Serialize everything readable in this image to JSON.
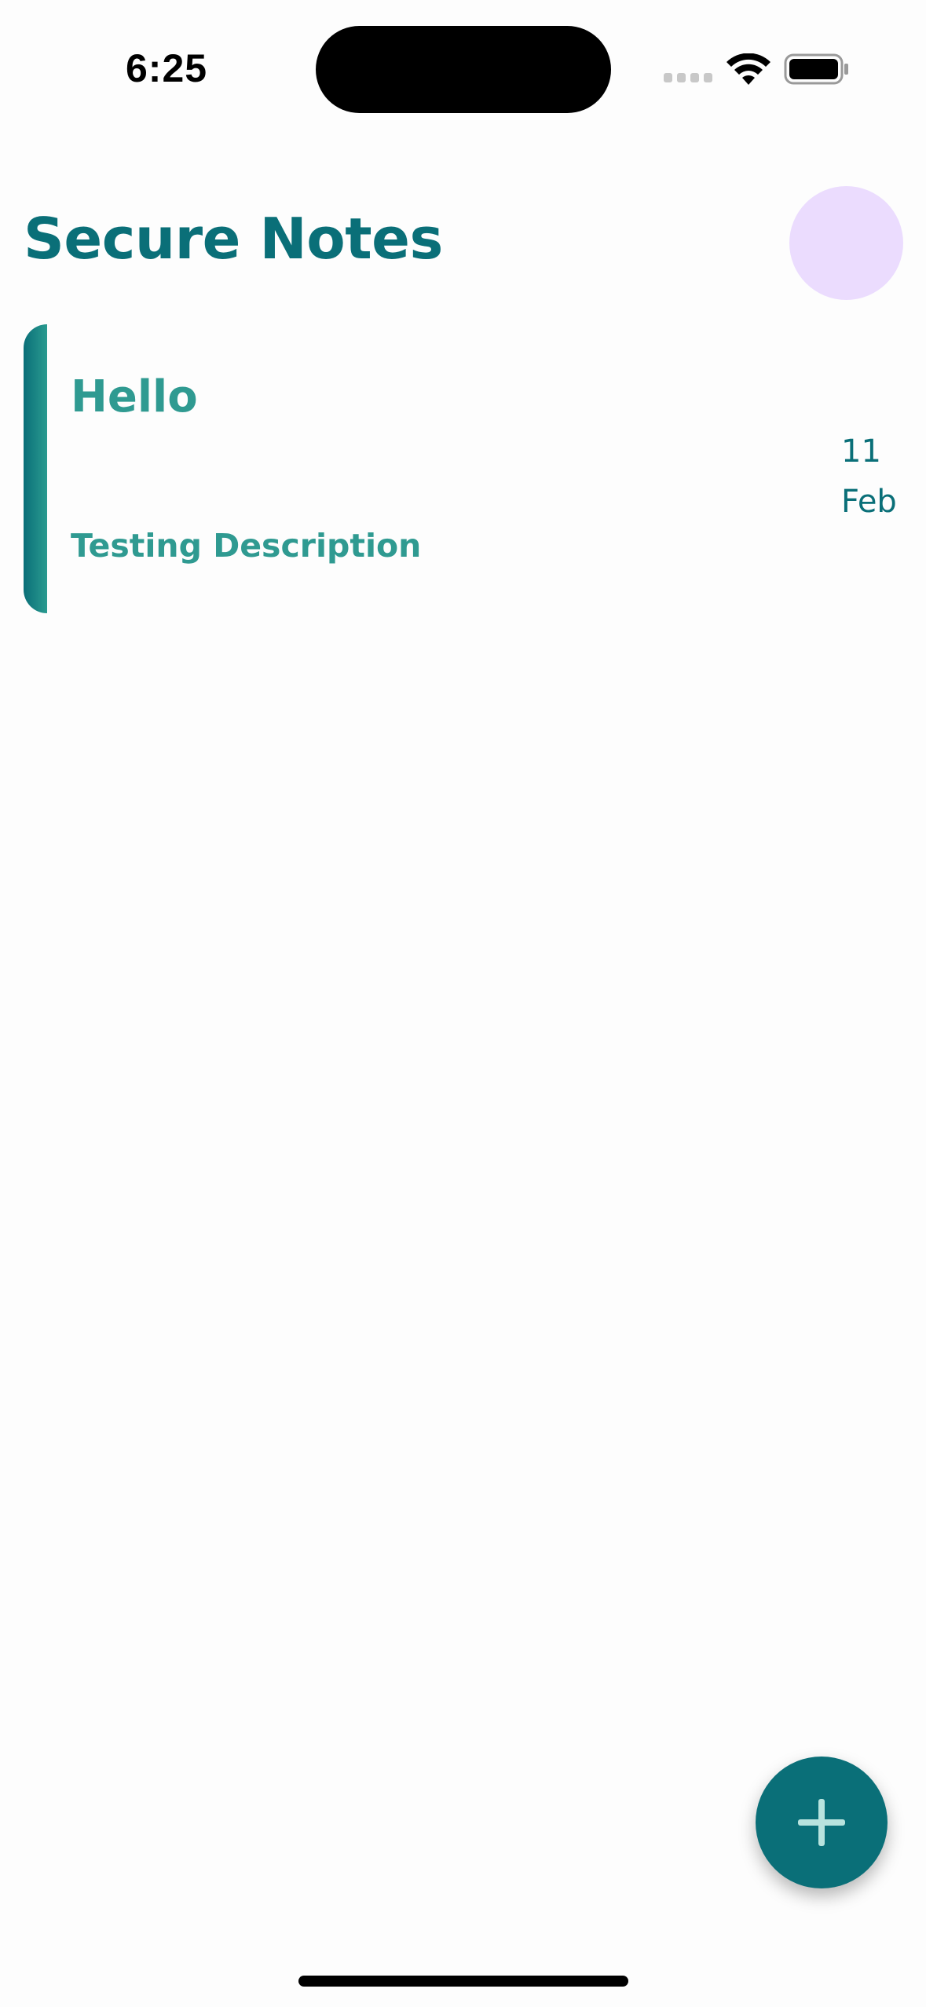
{
  "status_bar": {
    "time": "6:25",
    "icons": [
      "cellular-signal-icon",
      "wifi-icon",
      "battery-icon"
    ]
  },
  "header": {
    "title": "Secure Notes",
    "avatar_color": "#ebdcfe"
  },
  "notes": [
    {
      "title": "Hello",
      "description": "Testing Description",
      "date_day": "11",
      "date_month": "Feb"
    }
  ],
  "fab": {
    "icon": "plus-icon"
  },
  "colors": {
    "primary": "#0a6f78",
    "accent": "#2f9a91",
    "background": "#fdfdfd"
  }
}
